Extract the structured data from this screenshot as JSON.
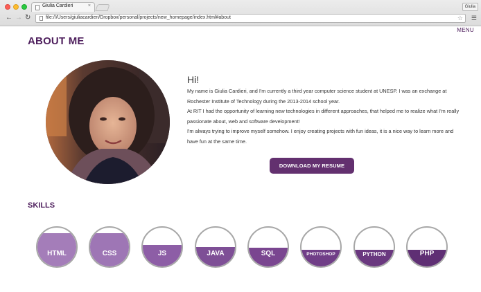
{
  "browser": {
    "tab_title": "Giulia Cardieri",
    "tab_close": "×",
    "profile_label": "Giulia",
    "url": "file:///Users/giuliacardieri/Dropbox/personal/projects/new_homepage/index.html#about",
    "icons": {
      "back": "back-arrow-icon",
      "forward": "forward-arrow-icon",
      "reload": "reload-icon",
      "bookmark": "star-icon",
      "menu": "hamburger-menu-icon"
    }
  },
  "page": {
    "menu_label": "MENU",
    "about_heading": "ABOUT ME",
    "greeting": "Hi!",
    "bio": [
      "My name is Giulia Cardieri, and I'm currently a third year computer science student at UNESP. I was an exchange at Rochester Institute of Technology during the 2013-2014 school year.",
      "At RIT I had the opportunity of learning new technologies in different approaches, that helped me to realize what I'm really passionate about, web and software development!",
      "I'm always trying to improve myself somehow. I enjoy creating projects with fun ideas, it is a nice way to learn more and have fun at the same time."
    ],
    "resume_button": "DOWNLOAD MY RESUME",
    "skills_heading": "SKILLS",
    "skills": [
      {
        "label": "HTML",
        "level": 0.85,
        "color": "#a47db9"
      },
      {
        "label": "CSS",
        "level": 0.85,
        "color": "#9e76b5"
      },
      {
        "label": "JS",
        "level": 0.55,
        "color": "#8d5ea6"
      },
      {
        "label": "JAVA",
        "level": 0.5,
        "color": "#7e4f96"
      },
      {
        "label": "SQL",
        "level": 0.48,
        "color": "#7a4690"
      },
      {
        "label": "PHOTOSHOP",
        "level": 0.42,
        "color": "#703e87"
      },
      {
        "label": "PYTHON",
        "level": 0.42,
        "color": "#6a387f"
      },
      {
        "label": "PHP",
        "level": 0.42,
        "color": "#5f2f74"
      }
    ],
    "colors": {
      "brand": "#4e1f5d",
      "button": "#63306f"
    }
  }
}
